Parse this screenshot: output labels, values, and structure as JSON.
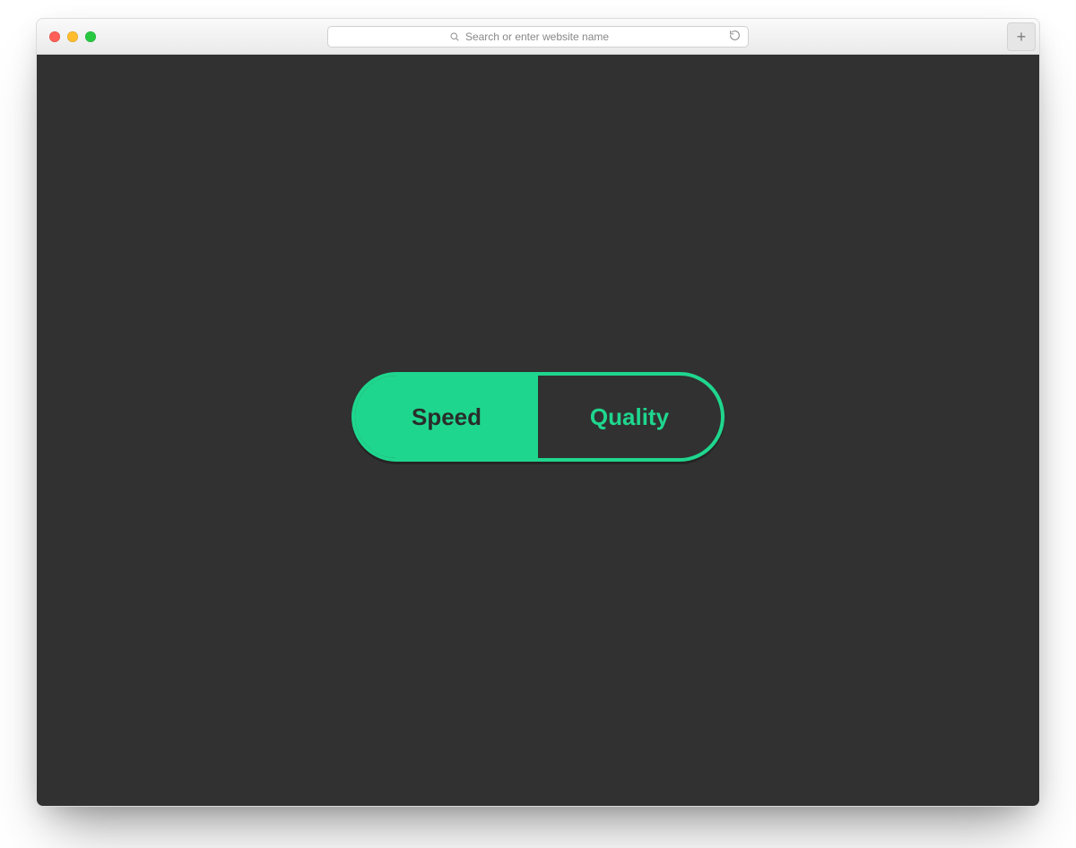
{
  "browser": {
    "url_placeholder": "Search or enter website name",
    "icons": {
      "search": "search-icon",
      "refresh": "refresh-icon",
      "new_tab_label": "+"
    }
  },
  "toggle": {
    "options": {
      "left": "Speed",
      "right": "Quality"
    },
    "selected": "left",
    "accent_color": "#1fd68e"
  }
}
